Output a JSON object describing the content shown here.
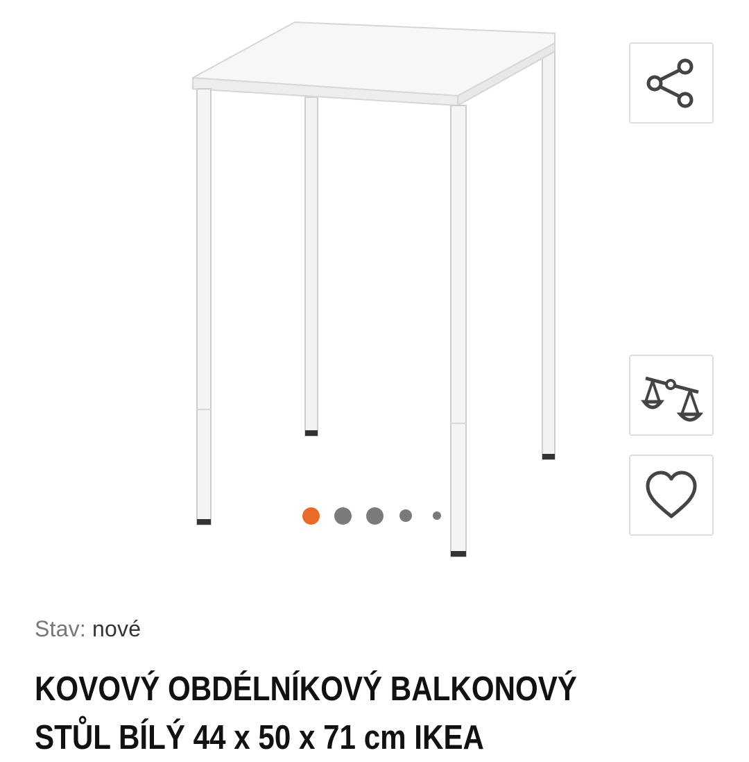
{
  "gallery": {
    "image_alt": "white metal rectangular table",
    "dot_count": 5,
    "active_index": 0,
    "colors": {
      "active_dot": "#ea6a2a",
      "inactive_dot": "#7a7a7a"
    }
  },
  "actions": {
    "share_icon": "share-icon",
    "compare_icon": "scales-icon",
    "favorite_icon": "heart-icon"
  },
  "product": {
    "condition_label": "Stav:",
    "condition_value": "nové",
    "title_line1": "KOVOVÝ OBDÉLNÍKOVÝ BALKONOVÝ",
    "title_line2": "STŮL BÍLÝ 44 x 50 x 71 cm IKEA"
  }
}
